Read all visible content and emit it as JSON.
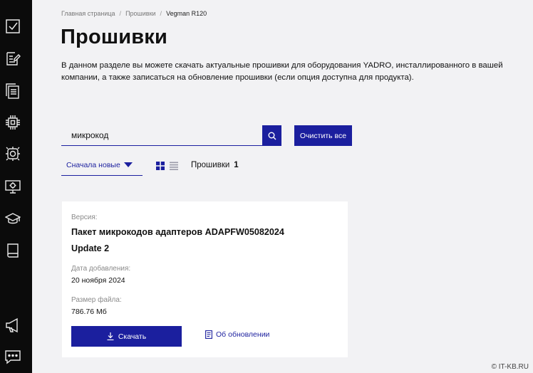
{
  "breadcrumb": [
    "Главная страница",
    "Прошивки",
    "Vegman R120"
  ],
  "page": {
    "title": "Прошивки",
    "description": "В данном разделе вы можете скачать актуальные прошивки для оборудования YADRO, инсталлированного в вашей компании, а также записаться на обновление прошивки (если опция доступна для продукта)."
  },
  "search": {
    "value": "микрокод",
    "clear_label": "Очистить все"
  },
  "sort": {
    "label": "Сначала новые"
  },
  "results": {
    "label": "Прошивки",
    "count": "1"
  },
  "card": {
    "version_label": "Версия:",
    "name": "Пакет микрокодов адаптеров ADAPFW05082024 Update 2",
    "date_label": "Дата добавления:",
    "date_value": "20 ноября 2024",
    "size_label": "Размер файла:",
    "size_value": "786.76 Мб",
    "download_label": "Скачать",
    "info_label": "Об обновлении"
  },
  "watermark": "© IT-KB.RU",
  "sidebar_icons": [
    "checkbox-icon",
    "edit-doc-icon",
    "docs-icon",
    "chip-icon",
    "processor-icon",
    "monitor-icon",
    "graduation-cap-icon",
    "book-icon",
    "megaphone-icon",
    "chat-icon"
  ],
  "colors": {
    "accent": "#1b1f9e",
    "sidebar": "#0b0b0b",
    "background": "#f2f2f4"
  }
}
